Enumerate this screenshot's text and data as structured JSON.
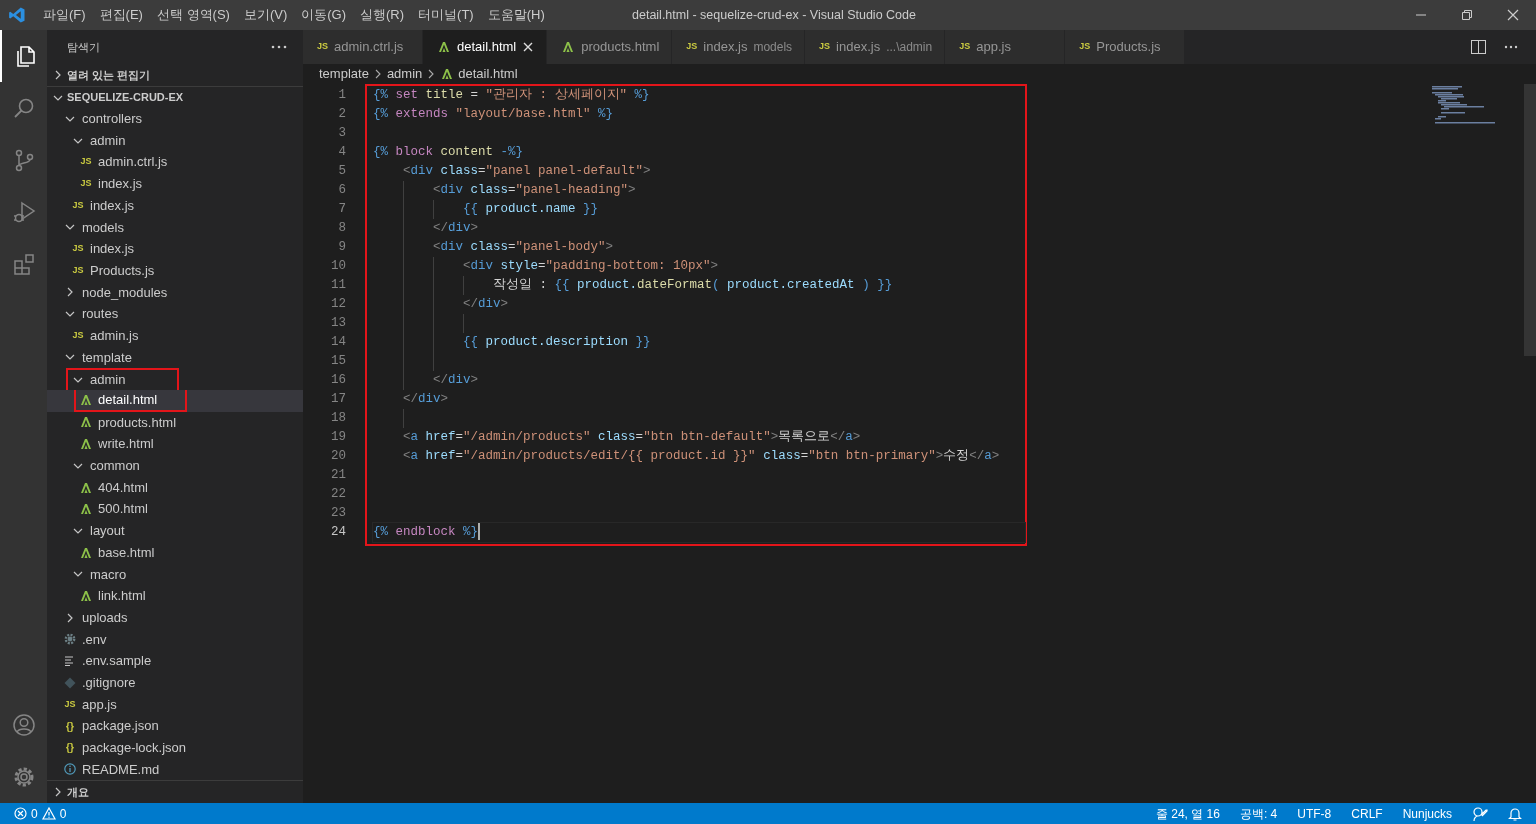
{
  "window": {
    "title": "detail.html - sequelize-crud-ex - Visual Studio Code"
  },
  "menu": [
    "파일(F)",
    "편집(E)",
    "선택 영역(S)",
    "보기(V)",
    "이동(G)",
    "실행(R)",
    "터미널(T)",
    "도움말(H)"
  ],
  "activity_bar": [
    {
      "kind": "files",
      "selected": true
    },
    {
      "kind": "search",
      "selected": false
    },
    {
      "kind": "source-control",
      "selected": false
    },
    {
      "kind": "run",
      "selected": false
    },
    {
      "kind": "extensions",
      "selected": false
    },
    {
      "kind": "account",
      "selected": false
    },
    {
      "kind": "settings",
      "selected": false
    }
  ],
  "sidebar": {
    "title": "탐색기",
    "sections": [
      {
        "label": "열려 있는 편집기",
        "expanded": false
      }
    ],
    "root": {
      "label": "SEQUELIZE-CRUD-EX",
      "expanded": true
    },
    "items": [
      {
        "label": "controllers",
        "kind": "folder",
        "expanded": true,
        "selected": false,
        "highlighted": false,
        "children": [
          {
            "label": "admin",
            "kind": "folder",
            "expanded": true,
            "selected": false,
            "highlighted": false,
            "children": [
              {
                "label": "admin.ctrl.js",
                "kind": "js",
                "badge": "JS",
                "selected": false,
                "highlighted": false
              },
              {
                "label": "index.js",
                "kind": "js",
                "badge": "JS",
                "selected": false,
                "highlighted": false
              }
            ]
          },
          {
            "label": "index.js",
            "kind": "js",
            "badge": "JS",
            "selected": false,
            "highlighted": false
          }
        ]
      },
      {
        "label": "models",
        "kind": "folder",
        "expanded": true,
        "selected": false,
        "highlighted": false,
        "children": [
          {
            "label": "index.js",
            "kind": "js",
            "badge": "JS",
            "selected": false,
            "highlighted": false
          },
          {
            "label": "Products.js",
            "kind": "js",
            "badge": "JS",
            "selected": false,
            "highlighted": false
          }
        ]
      },
      {
        "label": "node_modules",
        "kind": "folder",
        "expanded": false,
        "selected": false,
        "highlighted": false
      },
      {
        "label": "routes",
        "kind": "folder",
        "expanded": true,
        "selected": false,
        "highlighted": false,
        "children": [
          {
            "label": "admin.js",
            "kind": "js",
            "badge": "JS",
            "selected": false,
            "highlighted": false
          }
        ]
      },
      {
        "label": "template",
        "kind": "folder",
        "expanded": true,
        "selected": false,
        "highlighted": false,
        "children": [
          {
            "label": "admin",
            "kind": "folder",
            "expanded": true,
            "selected": false,
            "highlighted": true,
            "children": [
              {
                "label": "detail.html",
                "kind": "html",
                "selected": true,
                "highlighted": true
              },
              {
                "label": "products.html",
                "kind": "html",
                "selected": false,
                "highlighted": false
              },
              {
                "label": "write.html",
                "kind": "html",
                "selected": false,
                "highlighted": false
              }
            ]
          },
          {
            "label": "common",
            "kind": "folder",
            "expanded": true,
            "selected": false,
            "highlighted": false,
            "children": [
              {
                "label": "404.html",
                "kind": "html",
                "selected": false,
                "highlighted": false
              },
              {
                "label": "500.html",
                "kind": "html",
                "selected": false,
                "highlighted": false
              }
            ]
          },
          {
            "label": "layout",
            "kind": "folder",
            "expanded": true,
            "selected": false,
            "highlighted": false,
            "children": [
              {
                "label": "base.html",
                "kind": "html",
                "selected": false,
                "highlighted": false
              }
            ]
          },
          {
            "label": "macro",
            "kind": "folder",
            "expanded": true,
            "selected": false,
            "highlighted": false,
            "children": [
              {
                "label": "link.html",
                "kind": "html",
                "selected": false,
                "highlighted": false
              }
            ]
          }
        ]
      },
      {
        "label": "uploads",
        "kind": "folder",
        "expanded": false,
        "selected": false,
        "highlighted": false
      },
      {
        "label": ".env",
        "kind": "gear",
        "selected": false,
        "highlighted": false
      },
      {
        "label": ".env.sample",
        "kind": "lines",
        "selected": false,
        "highlighted": false
      },
      {
        "label": ".gitignore",
        "kind": "git",
        "selected": false,
        "highlighted": false
      },
      {
        "label": "app.js",
        "kind": "js",
        "badge": "JS",
        "selected": false,
        "highlighted": false
      },
      {
        "label": "package.json",
        "kind": "json",
        "badge": "{}",
        "selected": false,
        "highlighted": false
      },
      {
        "label": "package-lock.json",
        "kind": "json",
        "badge": "{}",
        "selected": false,
        "highlighted": false
      },
      {
        "label": "README.md",
        "kind": "info",
        "selected": false,
        "highlighted": false
      }
    ],
    "bottom_sections": [
      {
        "label": "개요",
        "expanded": false
      }
    ]
  },
  "tabs": [
    {
      "label": "admin.ctrl.js",
      "kind": "js",
      "badge": "JS",
      "selected": false
    },
    {
      "label": "detail.html",
      "kind": "html",
      "selected": true
    },
    {
      "label": "products.html",
      "kind": "html",
      "selected": false
    },
    {
      "label": "index.js",
      "description": "models",
      "kind": "js",
      "badge": "JS",
      "selected": false
    },
    {
      "label": "index.js",
      "description": "...\\admin",
      "kind": "js",
      "badge": "JS",
      "selected": false
    },
    {
      "label": "app.js",
      "kind": "js",
      "badge": "JS",
      "selected": false
    },
    {
      "label": "Products.js",
      "kind": "js",
      "badge": "JS",
      "selected": false
    }
  ],
  "breadcrumb": [
    {
      "label": "template",
      "kind": "folder"
    },
    {
      "label": "admin",
      "kind": "folder"
    },
    {
      "label": "detail.html",
      "kind": "html"
    }
  ],
  "editor": {
    "highlighted": true,
    "lines": [
      {
        "number": "1",
        "cursor": false,
        "tokens": [
          {
            "kind": "delim",
            "text": "{% "
          },
          {
            "kind": "keyword",
            "text": "set "
          },
          {
            "kind": "name",
            "text": "title"
          },
          {
            "kind": "text",
            "text": " = "
          },
          {
            "kind": "string",
            "text": "\"관리자 : 상세페이지\" "
          },
          {
            "kind": "delim",
            "text": "%}"
          }
        ]
      },
      {
        "number": "2",
        "cursor": false,
        "tokens": [
          {
            "kind": "delim",
            "text": "{% "
          },
          {
            "kind": "keyword",
            "text": "extends "
          },
          {
            "kind": "string",
            "text": "\"layout/base.html\" "
          },
          {
            "kind": "delim",
            "text": "%}"
          }
        ]
      },
      {
        "number": "3",
        "cursor": false
      },
      {
        "number": "4",
        "cursor": false,
        "tokens": [
          {
            "kind": "delim",
            "text": "{% "
          },
          {
            "kind": "keyword",
            "text": "block "
          },
          {
            "kind": "name",
            "text": "content "
          },
          {
            "kind": "delim",
            "text": "-%}"
          }
        ]
      },
      {
        "number": "5",
        "cursor": false,
        "tokens": [
          {
            "kind": "bracket",
            "text": "    <"
          },
          {
            "kind": "tag",
            "text": "div "
          },
          {
            "kind": "attr",
            "text": "class"
          },
          {
            "kind": "text",
            "text": "="
          },
          {
            "kind": "string",
            "text": "\"panel panel-default\""
          },
          {
            "kind": "bracket",
            "text": ">"
          }
        ]
      },
      {
        "number": "6",
        "cursor": false,
        "tokens": [
          {
            "kind": "bracket",
            "text": "        <"
          },
          {
            "kind": "tag",
            "text": "div "
          },
          {
            "kind": "attr",
            "text": "class"
          },
          {
            "kind": "text",
            "text": "="
          },
          {
            "kind": "string",
            "text": "\"panel-heading\""
          },
          {
            "kind": "bracket",
            "text": ">"
          }
        ]
      },
      {
        "number": "7",
        "cursor": false,
        "tokens": [
          {
            "kind": "delim",
            "text": "            {{ "
          },
          {
            "kind": "ident",
            "text": "product.name "
          },
          {
            "kind": "delim",
            "text": "}}"
          }
        ]
      },
      {
        "number": "8",
        "cursor": false,
        "tokens": [
          {
            "kind": "bracket",
            "text": "        </"
          },
          {
            "kind": "tag",
            "text": "div"
          },
          {
            "kind": "bracket",
            "text": ">"
          }
        ]
      },
      {
        "number": "9",
        "cursor": false,
        "tokens": [
          {
            "kind": "bracket",
            "text": "        <"
          },
          {
            "kind": "tag",
            "text": "div "
          },
          {
            "kind": "attr",
            "text": "class"
          },
          {
            "kind": "text",
            "text": "="
          },
          {
            "kind": "string",
            "text": "\"panel-body\""
          },
          {
            "kind": "bracket",
            "text": ">"
          }
        ]
      },
      {
        "number": "10",
        "cursor": false,
        "tokens": [
          {
            "kind": "bracket",
            "text": "            <"
          },
          {
            "kind": "tag",
            "text": "div "
          },
          {
            "kind": "attr",
            "text": "style"
          },
          {
            "kind": "text",
            "text": "="
          },
          {
            "kind": "string",
            "text": "\"padding-bottom: 10px\""
          },
          {
            "kind": "bracket",
            "text": ">"
          }
        ]
      },
      {
        "number": "11",
        "cursor": false,
        "tokens": [
          {
            "kind": "text",
            "text": "                작성일 : "
          },
          {
            "kind": "delim",
            "text": "{{ "
          },
          {
            "kind": "ident",
            "text": "product."
          },
          {
            "kind": "name",
            "text": "dateFormat"
          },
          {
            "kind": "delim",
            "text": "( "
          },
          {
            "kind": "ident",
            "text": "product.createdAt "
          },
          {
            "kind": "delim",
            "text": ") }}"
          }
        ]
      },
      {
        "number": "12",
        "cursor": false,
        "tokens": [
          {
            "kind": "bracket",
            "text": "            </"
          },
          {
            "kind": "tag",
            "text": "div"
          },
          {
            "kind": "bracket",
            "text": ">"
          }
        ]
      },
      {
        "number": "13",
        "cursor": false
      },
      {
        "number": "14",
        "cursor": false,
        "tokens": [
          {
            "kind": "delim",
            "text": "            {{ "
          },
          {
            "kind": "ident",
            "text": "product.description "
          },
          {
            "kind": "delim",
            "text": "}}"
          }
        ]
      },
      {
        "number": "15",
        "cursor": false
      },
      {
        "number": "16",
        "cursor": false,
        "tokens": [
          {
            "kind": "bracket",
            "text": "        </"
          },
          {
            "kind": "tag",
            "text": "div"
          },
          {
            "kind": "bracket",
            "text": ">"
          }
        ]
      },
      {
        "number": "17",
        "cursor": false,
        "tokens": [
          {
            "kind": "bracket",
            "text": "    </"
          },
          {
            "kind": "tag",
            "text": "div"
          },
          {
            "kind": "bracket",
            "text": ">"
          }
        ]
      },
      {
        "number": "18",
        "cursor": false
      },
      {
        "number": "19",
        "cursor": false,
        "tokens": [
          {
            "kind": "bracket",
            "text": "    <"
          },
          {
            "kind": "tag",
            "text": "a "
          },
          {
            "kind": "attr",
            "text": "href"
          },
          {
            "kind": "text",
            "text": "="
          },
          {
            "kind": "string",
            "text": "\"/admin/products\" "
          },
          {
            "kind": "attr",
            "text": "class"
          },
          {
            "kind": "text",
            "text": "="
          },
          {
            "kind": "string",
            "text": "\"btn btn-default\""
          },
          {
            "kind": "bracket",
            "text": ">"
          },
          {
            "kind": "text",
            "text": "목록으로"
          },
          {
            "kind": "bracket",
            "text": "</"
          },
          {
            "kind": "tag",
            "text": "a"
          },
          {
            "kind": "bracket",
            "text": ">"
          }
        ]
      },
      {
        "number": "20",
        "cursor": false,
        "tokens": [
          {
            "kind": "bracket",
            "text": "    <"
          },
          {
            "kind": "tag",
            "text": "a "
          },
          {
            "kind": "attr",
            "text": "href"
          },
          {
            "kind": "text",
            "text": "="
          },
          {
            "kind": "string",
            "text": "\"/admin/products/edit/{{ product.id }}\" "
          },
          {
            "kind": "attr",
            "text": "class"
          },
          {
            "kind": "text",
            "text": "="
          },
          {
            "kind": "string",
            "text": "\"btn btn-primary\""
          },
          {
            "kind": "bracket",
            "text": ">"
          },
          {
            "kind": "text",
            "text": "수정"
          },
          {
            "kind": "bracket",
            "text": "</"
          },
          {
            "kind": "tag",
            "text": "a"
          },
          {
            "kind": "bracket",
            "text": ">"
          }
        ]
      },
      {
        "number": "21",
        "cursor": false
      },
      {
        "number": "22",
        "cursor": false
      },
      {
        "number": "23",
        "cursor": false
      },
      {
        "number": "24",
        "cursor": true,
        "tokens": [
          {
            "kind": "delim",
            "text": "{% "
          },
          {
            "kind": "keyword",
            "text": "endblock "
          },
          {
            "kind": "delim",
            "text": "%}"
          }
        ]
      }
    ]
  },
  "status_bar": {
    "errors": "0",
    "warnings": "0",
    "items": [
      "줄 24, 열 16",
      "공백: 4",
      "UTF-8",
      "CRLF",
      "Nunjucks"
    ]
  }
}
